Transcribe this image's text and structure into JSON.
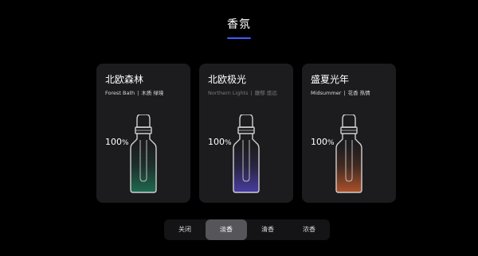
{
  "header": {
    "title": "香氛"
  },
  "cards": [
    {
      "name": "北欧森林",
      "en": "Forest Bath",
      "sep": "|",
      "tags": "木质 绿境",
      "percent_value": "100",
      "percent_unit": "%",
      "liquid_color": "#1f6e52"
    },
    {
      "name": "北欧极光",
      "en": "Northern Lights",
      "sep": "|",
      "tags": "馥郁 悠远",
      "percent_value": "100",
      "percent_unit": "%",
      "liquid_color": "#4a3fa8"
    },
    {
      "name": "盛夏光年",
      "en": "Midsummer",
      "sep": "|",
      "tags": "花香 热情",
      "percent_value": "100",
      "percent_unit": "%",
      "liquid_color": "#b4542a"
    }
  ],
  "mode_selector": {
    "options": [
      "关闭",
      "淡香",
      "清香",
      "浓香"
    ],
    "selected": "淡香"
  },
  "colors": {
    "background": "#000000",
    "card": "#1c1c1e",
    "accent_underline": "#3d5cff",
    "selected_segment": "#55555a"
  }
}
